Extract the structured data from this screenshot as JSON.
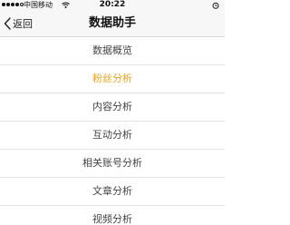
{
  "status_bar": {
    "carrier": "中国移动",
    "time": "20:22",
    "signal_icon": "signal-dots-icon",
    "wifi_icon": "wifi-icon",
    "alarm_icon": "alarm-icon"
  },
  "nav": {
    "back_label": "返回",
    "back_icon": "chevron-left-icon",
    "title": "数据助手"
  },
  "menu": {
    "items": [
      {
        "label": "数据概览"
      },
      {
        "label": "粉丝分析"
      },
      {
        "label": "内容分析"
      },
      {
        "label": "互动分析"
      },
      {
        "label": "相关账号分析"
      },
      {
        "label": "文章分析"
      },
      {
        "label": "视频分析"
      }
    ],
    "active_index": 1
  },
  "colors": {
    "accent": "#f5a019",
    "bar_background": "#f7f7f7",
    "text": "#444444"
  }
}
